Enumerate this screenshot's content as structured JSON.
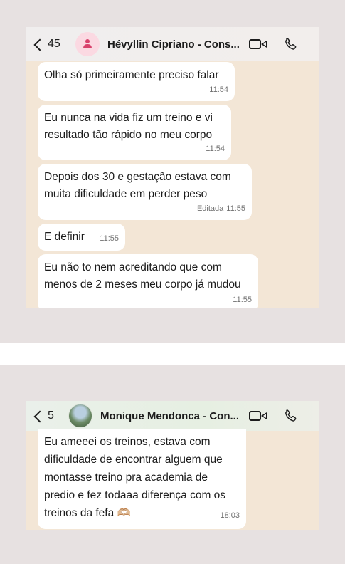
{
  "chat1": {
    "back_count": "45",
    "contact_name": "Hévyllin Cipriano - Cons...",
    "messages": [
      {
        "text": "Olha só primeiramente preciso falar",
        "time": "11:54"
      },
      {
        "text": "Eu nunca na vida fiz um treino e vi resultado tão rápido no meu corpo",
        "time": "11:54"
      },
      {
        "text": "Depois dos 30 e gestação estava com muita dificuldade em perder peso",
        "time": "11:55",
        "edited": "Editada"
      },
      {
        "text": "E definir",
        "time": "11:55"
      },
      {
        "text": "Eu não to nem acreditando que com menos de 2 meses meu corpo já mudou",
        "time": "11:55"
      }
    ]
  },
  "chat2": {
    "back_count": "5",
    "contact_name": "Monique Mendonca - Con...",
    "messages": [
      {
        "text": "Eu ameeei os treinos, estava com dificuldade de encontrar alguem que montasse treino pra academia de predio e fez todaaa diferença com os treinos da fefa 🫶🏼",
        "time": "18:03"
      }
    ]
  },
  "icons": [
    "back-chevron-icon",
    "contact-avatar-icon",
    "video-call-icon",
    "phone-icon"
  ]
}
